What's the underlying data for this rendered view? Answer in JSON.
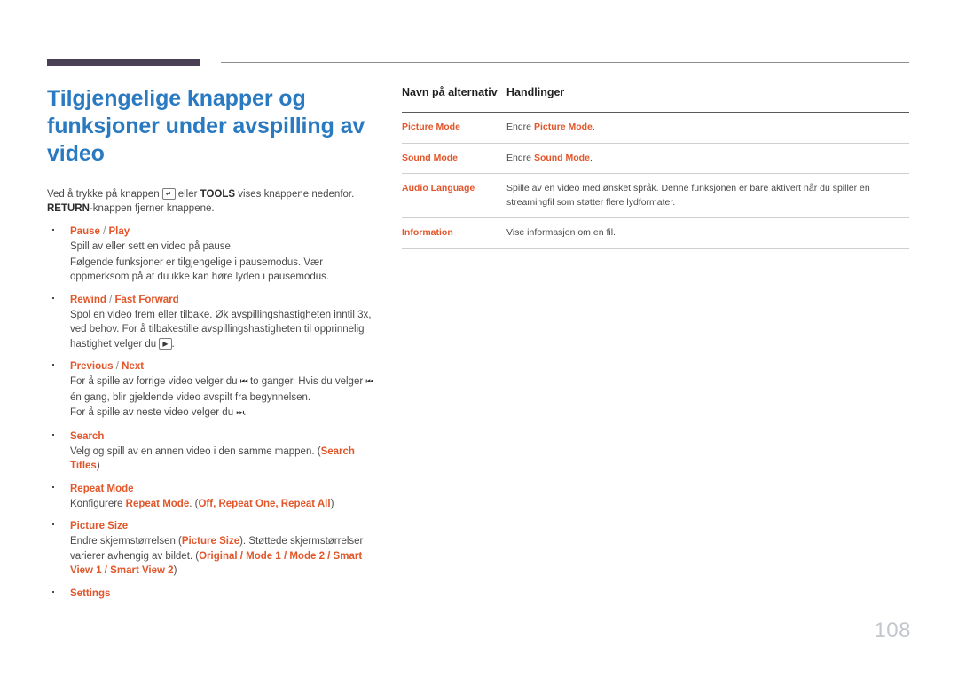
{
  "page": {
    "number": "108",
    "accent_blue": "#2a7ac2",
    "accent_orange": "#e2562a",
    "rule_purple": "#4a4056",
    "body_gray": "#4a4a4a"
  },
  "title": "Tilgjengelige knapper og funksjoner under avspilling av video",
  "intro": {
    "part1": "Ved å trykke på knappen ",
    "icon1": "enter-key-icon",
    "part2": " eller ",
    "bold1": "TOOLS",
    "part3": " vises knappene nedenfor. ",
    "bold2": "RETURN",
    "part4": "-knappen fjerner knappene."
  },
  "bullets": [
    {
      "term_main": "Pause",
      "term_sep": " / ",
      "term_alt": "Play",
      "lines": [
        "Spill av eller sett en video på pause.",
        "Følgende funksjoner er tilgjengelige i pausemodus. Vær oppmerksom på at du ikke kan høre lyden i pausemodus."
      ]
    },
    {
      "term_main": "Rewind",
      "term_sep": " / ",
      "term_alt": "Fast Forward",
      "lines": [
        "Spol en video frem eller tilbake. Øk avspillingshastigheten inntil 3x, ved behov. For å tilbakestille avspillingshastigheten til opprinnelig hastighet velger du "
      ],
      "trailing_icon": "play-key-icon",
      "trailing_text": "."
    },
    {
      "term_main": "Previous",
      "term_sep": " / ",
      "term_alt": "Next",
      "lines_rich": [
        {
          "a": "For å spille av forrige video velger du ",
          "icon1": "skip-back-icon",
          "b": " to ganger. Hvis du velger ",
          "icon2": "skip-back-icon",
          "c": " én gang, blir gjeldende video avspilt fra begynnelsen."
        },
        {
          "a": "For å spille av neste video velger du ",
          "icon1": "skip-forward-icon",
          "b": "."
        }
      ]
    },
    {
      "term_main": "Search",
      "term_sep": "",
      "term_alt": "",
      "desc_pre": "Velg og spill av en annen video i den samme mappen. (",
      "desc_bold": "Search Titles",
      "desc_post": ")"
    },
    {
      "term_main": "Repeat Mode",
      "term_sep": "",
      "term_alt": "",
      "desc_pre": "Konfigurere ",
      "desc_bold": "Repeat Mode",
      "desc_mid": ". (",
      "desc_opts": "Off, Repeat One, Repeat All",
      "desc_post": ")"
    },
    {
      "term_main": "Picture Size",
      "term_sep": "",
      "term_alt": "",
      "desc_pre": "Endre skjermstørrelsen (",
      "desc_bold": "Picture Size",
      "desc_mid": "). Støttede skjermstørrelser varierer avhengig av bildet. (",
      "desc_opts": "Original / Mode 1 / Mode 2 / Smart View 1 / Smart View 2",
      "desc_post": ")"
    },
    {
      "term_main": "Settings",
      "term_sep": "",
      "term_alt": "",
      "lines": []
    }
  ],
  "table": {
    "headers": {
      "name": "Navn på alternativ",
      "action": "Handlinger"
    },
    "rows": [
      {
        "name": "Picture Mode",
        "action_pre": "Endre ",
        "action_bold": "Picture Mode",
        "action_post": "."
      },
      {
        "name": "Sound Mode",
        "action_pre": "Endre ",
        "action_bold": "Sound Mode",
        "action_post": "."
      },
      {
        "name": "Audio Language",
        "action_pre": "Spille av en video med ønsket språk. Denne funksjonen er bare aktivert når du spiller en streamingfil som støtter flere lydformater.",
        "action_bold": "",
        "action_post": ""
      },
      {
        "name": "Information",
        "action_pre": "Vise informasjon om en fil.",
        "action_bold": "",
        "action_post": ""
      }
    ]
  }
}
